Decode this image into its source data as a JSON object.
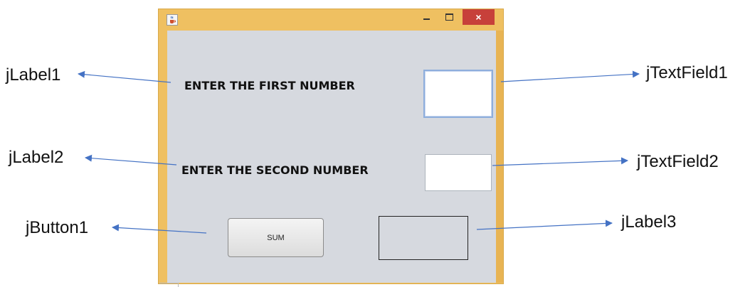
{
  "window": {
    "icon": "java-cup-icon",
    "controls": {
      "minimize": "minimize-icon",
      "maximize": "maximize-icon",
      "close": "×"
    }
  },
  "form": {
    "label1": "ENTER THE FIRST NUMBER",
    "label2": "ENTER THE SECOND NUMBER",
    "textfield1_value": "",
    "textfield2_value": "",
    "button_label": "SUM",
    "result_value": ""
  },
  "annotations": {
    "jLabel1": "jLabel1",
    "jLabel2": "jLabel2",
    "jButton1": "jButton1",
    "jTextField1": "jTextField1",
    "jTextField2": "jTextField2",
    "jLabel3": "jLabel3"
  },
  "colors": {
    "frame": "#efc061",
    "client": "#d6d9df",
    "close": "#c7403a",
    "arrow": "#4472c4"
  }
}
